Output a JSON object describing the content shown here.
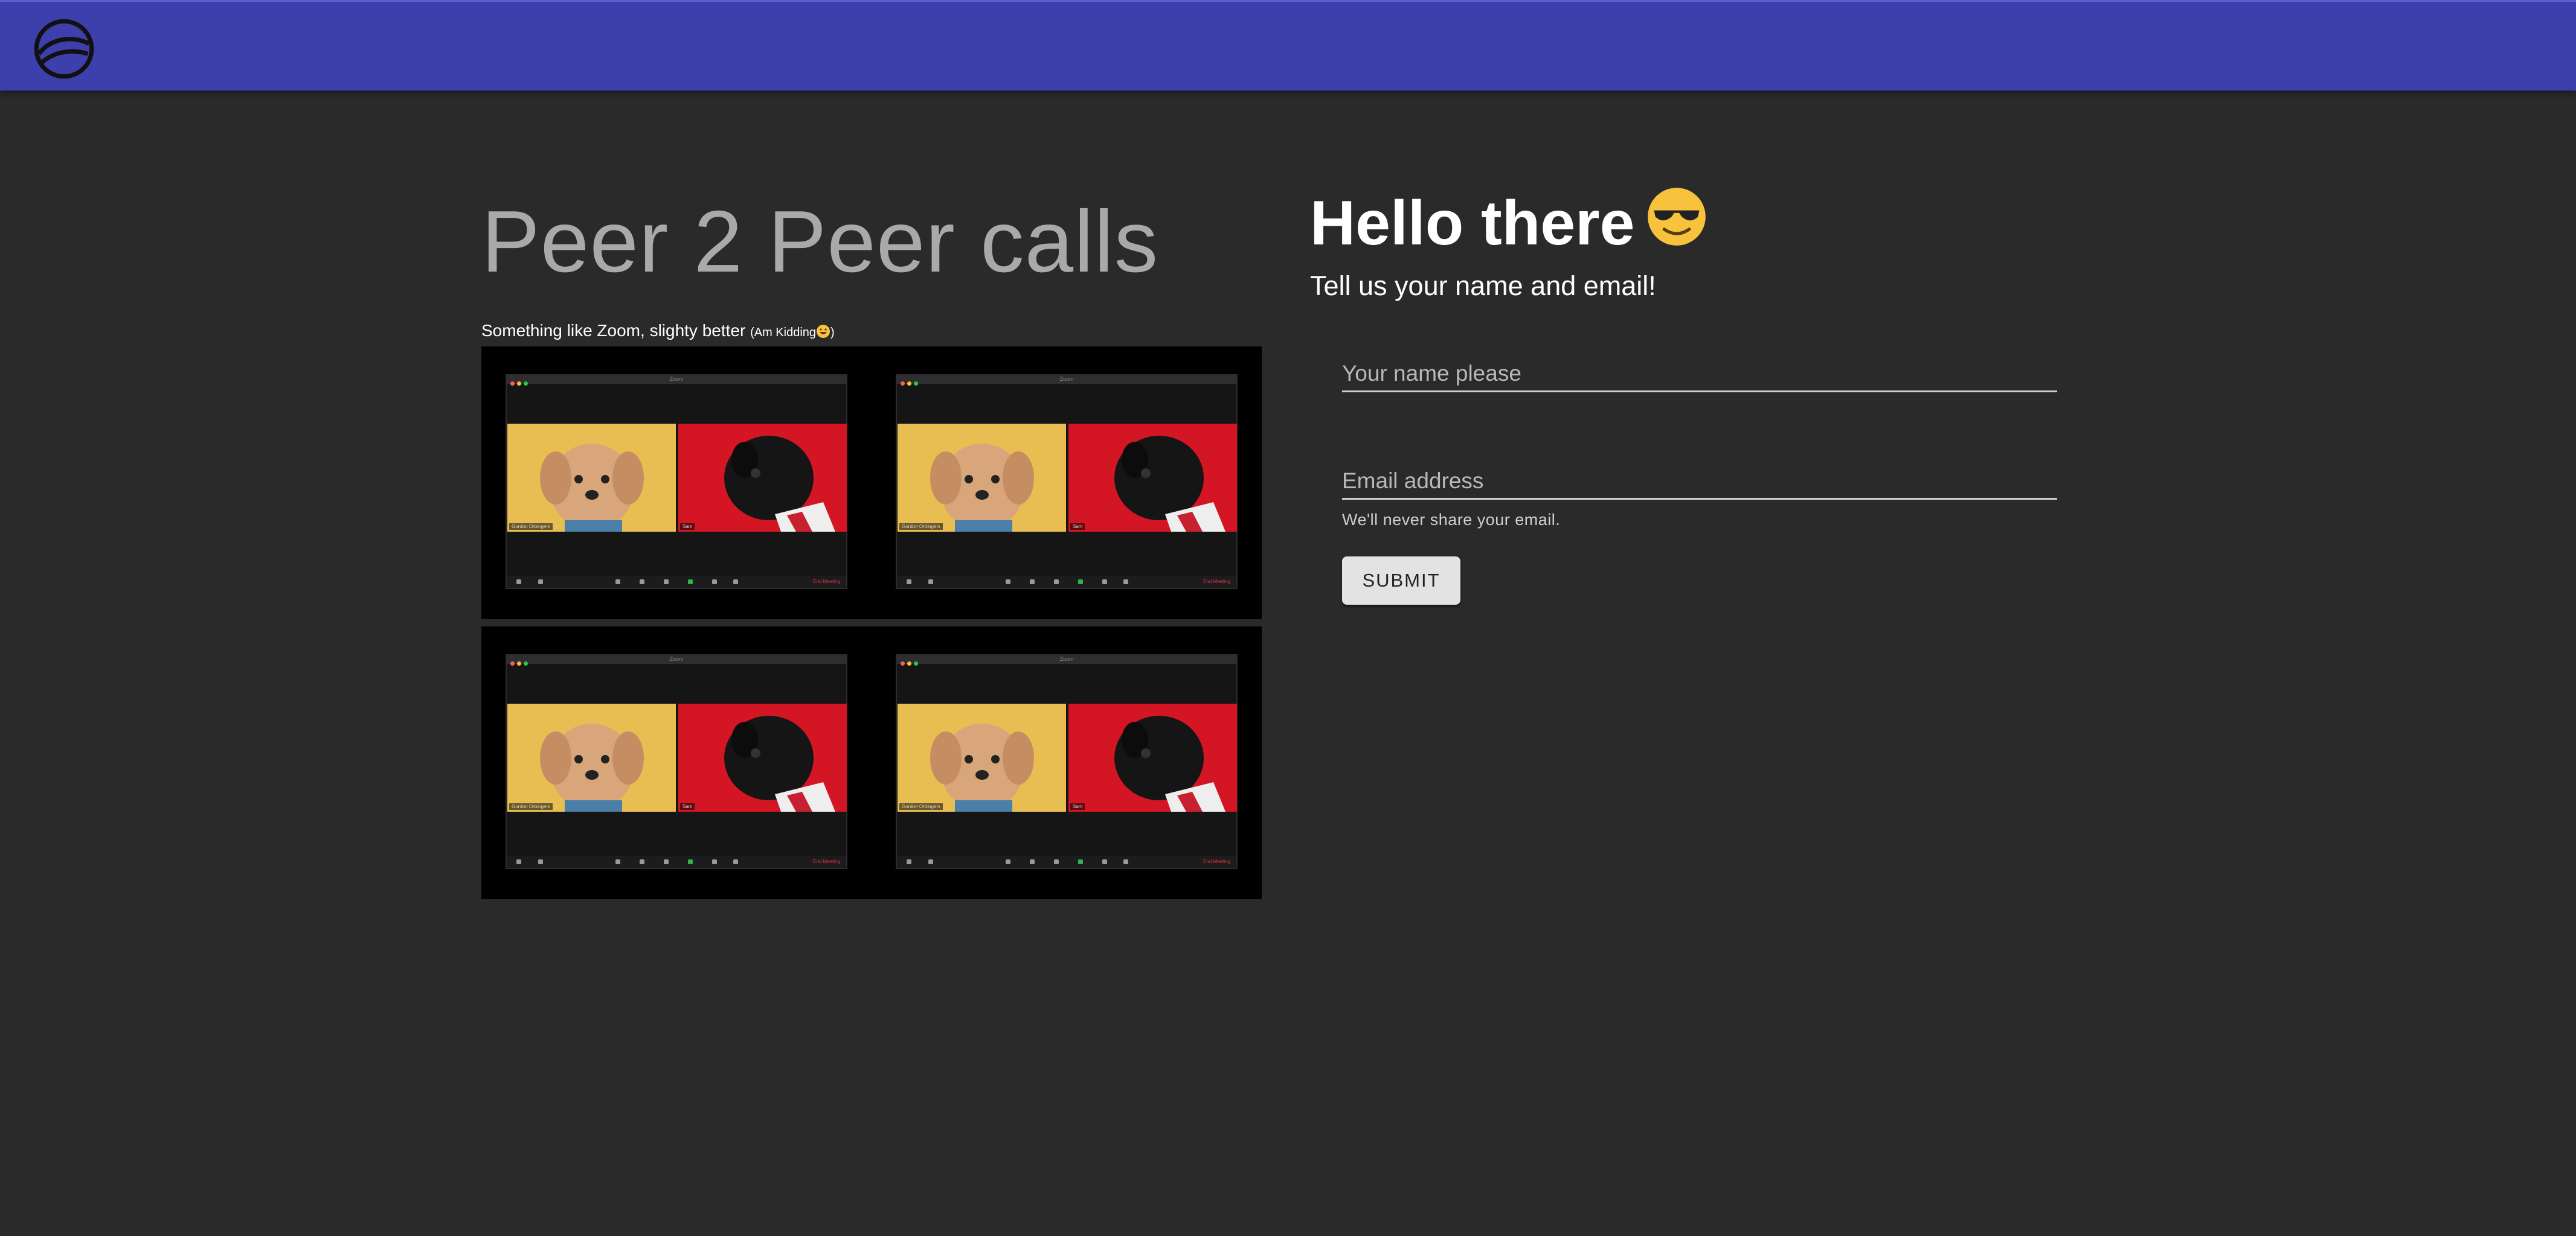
{
  "header": {
    "logo_icon": "planet-logo-icon",
    "background_color": "#3d3fad"
  },
  "hero": {
    "title": "Peer 2 Peer calls",
    "tagline": "Something like Zoom, slighty better",
    "tagline_note": "(Am Kidding",
    "tagline_emoji_icon": "grinning-face-icon",
    "tagline_note_close": ")"
  },
  "preview": {
    "window_title": "Zoom",
    "participants": [
      "Gordon Orbingers",
      "Sam"
    ],
    "end_label": "End Meeting",
    "tile_colors": [
      "#e8bd52",
      "#d31524"
    ]
  },
  "form": {
    "greeting": "Hello there",
    "greeting_emoji_icon": "sunglasses-face-icon",
    "subtitle": "Tell us your name and email!",
    "name_placeholder": "Your name please",
    "email_placeholder": "Email address",
    "email_helper": "We'll never share your email.",
    "submit_label": "SUBMIT"
  }
}
